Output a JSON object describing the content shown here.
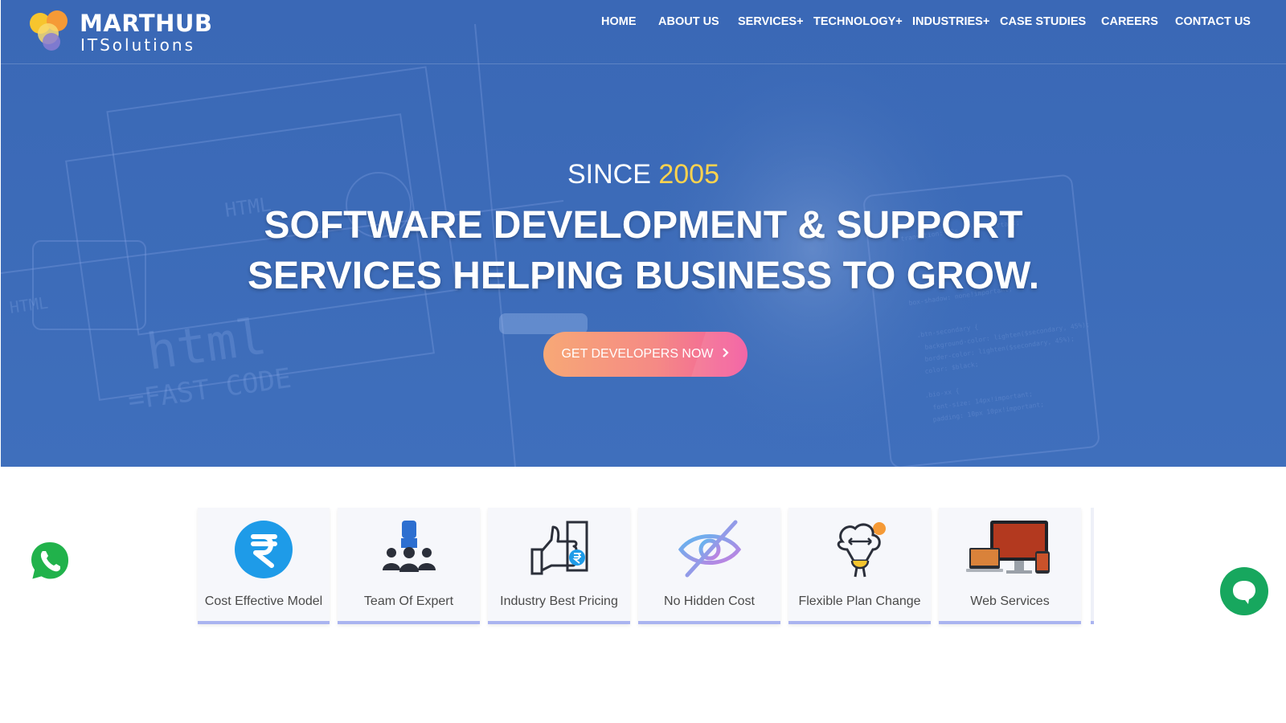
{
  "brand": {
    "name": "MARTHUB",
    "tagline": "ITSolutions"
  },
  "nav": [
    {
      "label": "HOME"
    },
    {
      "label": "ABOUT US"
    },
    {
      "label": "SERVICES+"
    },
    {
      "label": "TECHNOLOGY+"
    },
    {
      "label": "INDUSTRIES+"
    },
    {
      "label": "CASE STUDIES"
    },
    {
      "label": "CAREERS"
    },
    {
      "label": "CONTACT US"
    }
  ],
  "hero": {
    "since_prefix": "SINCE",
    "since_year": "2005",
    "headline_line1": "SOFTWARE DEVELOPMENT & SUPPORT",
    "headline_line2": "SERVICES HELPING BUSINESS TO GROW.",
    "cta_label": "GET DEVELOPERS NOW",
    "cta_icon": "chevron-right-icon"
  },
  "features": [
    {
      "label": "Cost Effective Model",
      "icon": "rupee-icon"
    },
    {
      "label": "Team Of Expert",
      "icon": "team-icon"
    },
    {
      "label": "Industry Best Pricing",
      "icon": "thumbs-up-price-icon"
    },
    {
      "label": "No Hidden Cost",
      "icon": "eye-off-icon"
    },
    {
      "label": "Flexible Plan Change",
      "icon": "flexible-plan-icon"
    },
    {
      "label": "Web Services",
      "icon": "devices-icon"
    }
  ],
  "floating": {
    "whatsapp_icon": "whatsapp-icon",
    "chat_icon": "chat-bubble-icon"
  },
  "colors": {
    "hero_bg": "#3c6bb8",
    "accent_year": "#ffd34e",
    "cta_start": "#f7a876",
    "cta_end": "#f25aa0",
    "card_border": "#aab4f0",
    "chat": "#17a75e"
  }
}
